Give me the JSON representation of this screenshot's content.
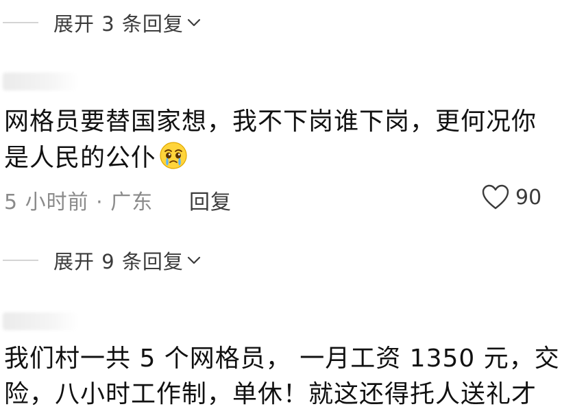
{
  "thread1": {
    "expand_label": "展开 3 条回复"
  },
  "comment1": {
    "text_line1": "网格员要替国家想，我不下岗谁下岗，更何况你",
    "text_line2": "是人民的公仆",
    "emoji": "crying-face-emoji",
    "time_location": "5 小时前 · 广东",
    "reply_label": "回复",
    "like_count": "90"
  },
  "thread2": {
    "expand_label": "展开 9 条回复"
  },
  "comment2": {
    "text_line1": "我们村一共 5 个网格员， 一月工资 1350 元，交",
    "text_line2": "险，八小时工作制，单休！就这还得托人送礼才"
  },
  "colors": {
    "text_primary": "#111111",
    "text_secondary": "#8a8a8a",
    "text_action": "#3b3b3b",
    "divider": "#d4d4d4"
  }
}
